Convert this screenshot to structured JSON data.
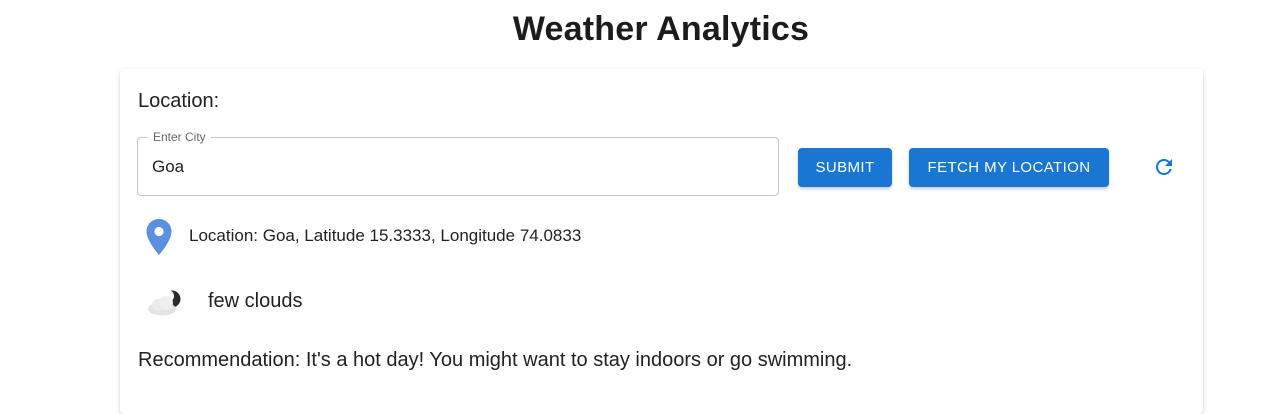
{
  "header": {
    "title": "Weather Analytics"
  },
  "location_section": {
    "label": "Location:",
    "city_field": {
      "legend": "Enter City",
      "value": "Goa"
    },
    "submit_label": "SUBMIT",
    "fetch_label": "FETCH MY LOCATION",
    "refresh_icon": "refresh-icon"
  },
  "location_info": {
    "icon": "map-pin-icon",
    "text": "Location: Goa, Latitude 15.3333, Longitude 74.0833"
  },
  "condition": {
    "icon": "few-clouds-icon",
    "text": "few clouds"
  },
  "recommendation": {
    "text": "Recommendation: It's a hot day! You might want to stay indoors or go swimming."
  },
  "colors": {
    "primary": "#1976d2",
    "pin": "#5b8fe0",
    "text": "#222222"
  }
}
